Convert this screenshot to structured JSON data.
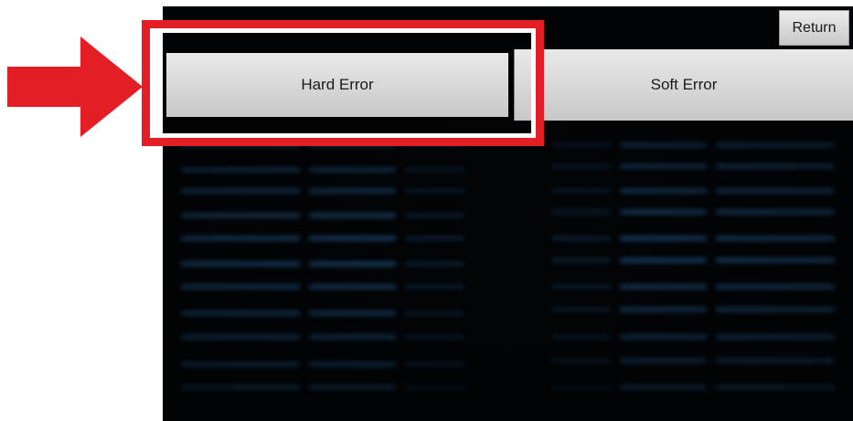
{
  "header": {
    "return_label": "Return"
  },
  "tabs": [
    {
      "label": "Hard Error",
      "highlighted": true
    },
    {
      "label": "Soft Error",
      "highlighted": false
    }
  ],
  "annotation": {
    "highlight_color": "#e31e24",
    "arrow_icon": "right-arrow-icon"
  },
  "colors": {
    "screen_background": "#000000",
    "glow": "#2a6fb0"
  }
}
